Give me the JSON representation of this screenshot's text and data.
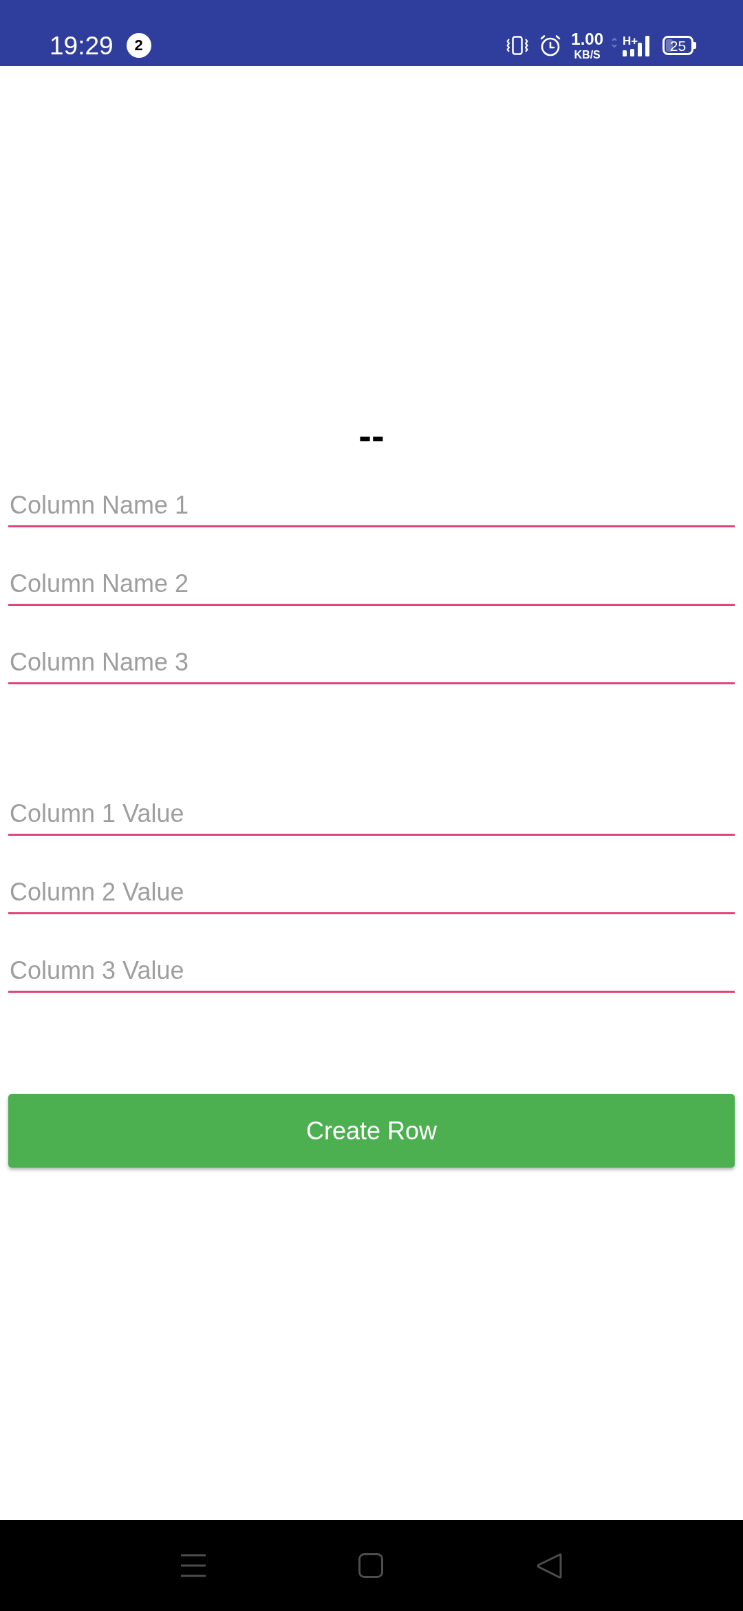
{
  "status_bar": {
    "time": "19:29",
    "notification_count": "2",
    "net_speed": "1.00",
    "net_speed_unit": "KB/S",
    "network_type": "H+",
    "battery": "25"
  },
  "title": "--",
  "column_name_fields": [
    {
      "placeholder": "Column Name 1"
    },
    {
      "placeholder": "Column Name 2"
    },
    {
      "placeholder": "Column Name 3"
    }
  ],
  "column_value_fields": [
    {
      "placeholder": "Column 1 Value"
    },
    {
      "placeholder": "Column 2 Value"
    },
    {
      "placeholder": "Column 3 Value"
    }
  ],
  "button": {
    "label": "Create Row"
  }
}
